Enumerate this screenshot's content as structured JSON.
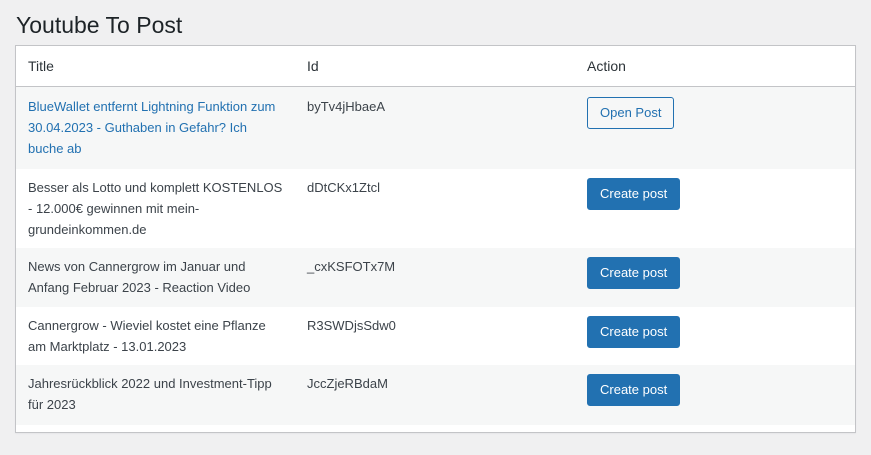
{
  "page": {
    "title": "Youtube To Post"
  },
  "table": {
    "headers": {
      "title": "Title",
      "id": "Id",
      "action": "Action"
    },
    "rows": [
      {
        "title": "BlueWallet entfernt Lightning Funktion zum 30.04.2023 - Guthaben in Gefahr? Ich buche ab",
        "id": "byTv4jHbaeA",
        "action": "Open Post"
      },
      {
        "title": "Besser als Lotto und komplett KOSTENLOS - 12.000€ gewinnen mit mein-grundeinkommen.de",
        "id": "dDtCKx1Ztcl",
        "action": "Create post"
      },
      {
        "title": "News von Cannergrow im Januar und Anfang Februar 2023 - Reaction Video",
        "id": "_cxKSFOTx7M",
        "action": "Create post"
      },
      {
        "title": "Cannergrow - Wieviel kostet eine Pflanze am Marktplatz - 13.01.2023",
        "id": "R3SWDjsSdw0",
        "action": "Create post"
      },
      {
        "title": "Jahresrückblick 2022 und Investment-Tipp für 2023",
        "id": "JccZjeRBdaM",
        "action": "Create post"
      }
    ]
  },
  "colors": {
    "accent": "#2271b1",
    "background": "#f0f0f1",
    "row_alt": "#f6f7f7"
  }
}
